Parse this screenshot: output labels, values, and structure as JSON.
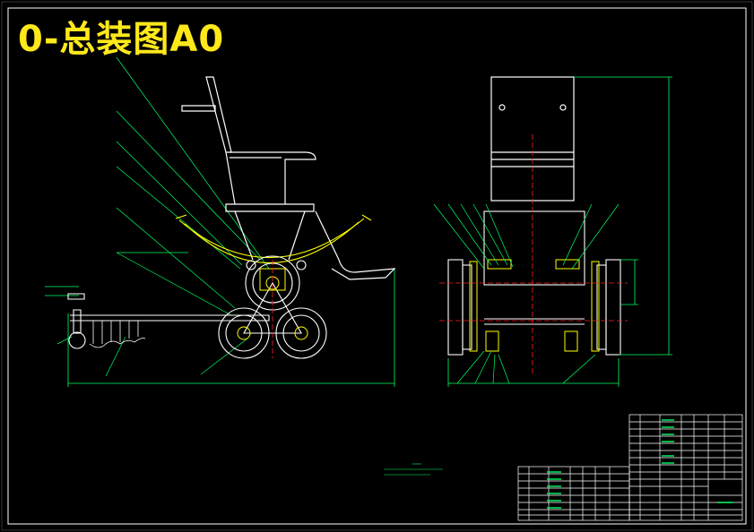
{
  "title": "0-总装图A0",
  "colors": {
    "background": "#000000",
    "outline": "#ffffff",
    "part": "#ffff00",
    "dimension": "#00ff66",
    "centerline": "#ff2222",
    "title_text": "#ffe81a"
  }
}
